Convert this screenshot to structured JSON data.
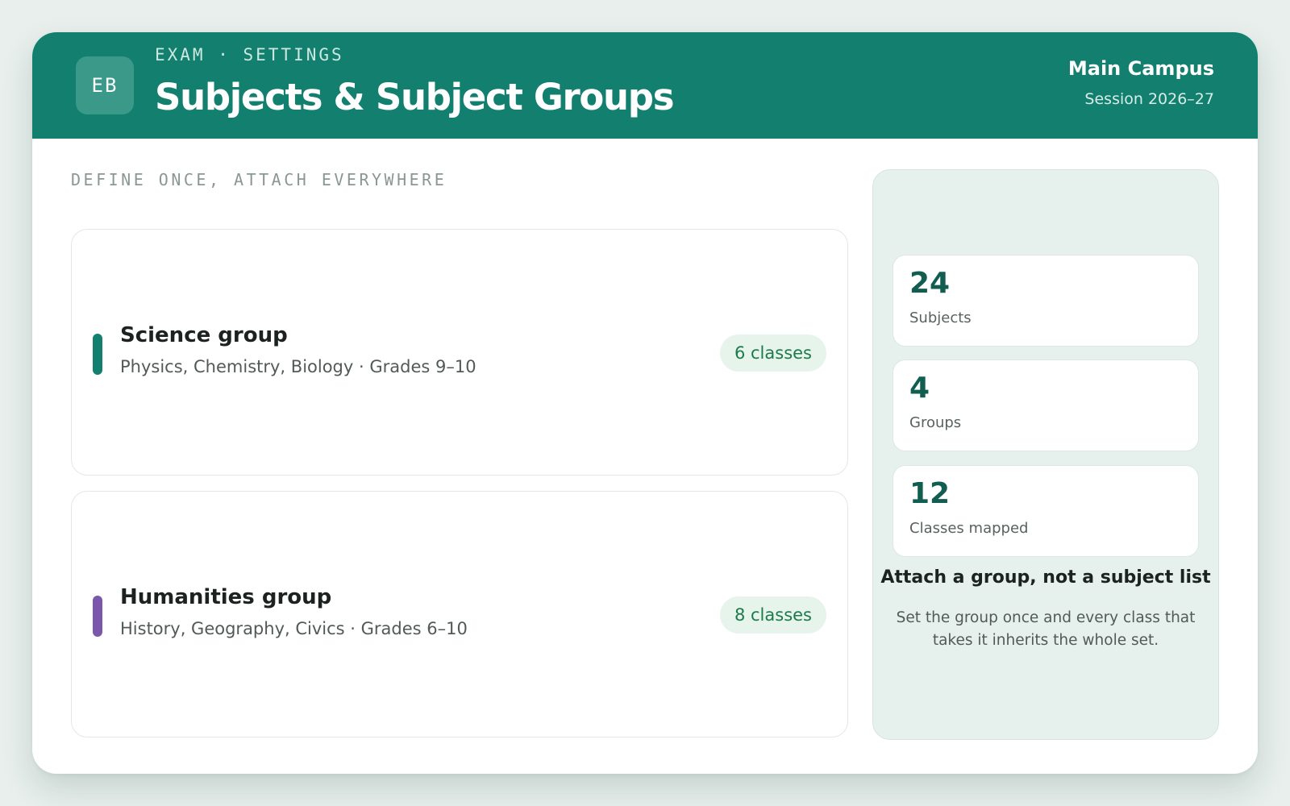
{
  "header": {
    "logo_text": "EB",
    "eyebrow": "EXAM · SETTINGS",
    "title": "Subjects & Subject Groups",
    "campus": "Main Campus",
    "session": "Session 2026–27"
  },
  "main": {
    "section_label": "DEFINE ONCE, ATTACH EVERYWHERE",
    "groups": [
      {
        "name": "Science group",
        "description": "Physics, Chemistry, Biology · Grades 9–10",
        "classes": "6 classes",
        "accent_color": "#137f6f"
      },
      {
        "name": "Humanities group",
        "description": "History, Geography, Civics · Grades 6–10",
        "classes": "8 classes",
        "accent_color": "#7b57ab"
      }
    ]
  },
  "summary": {
    "stats": [
      {
        "value": "24",
        "label": "Subjects"
      },
      {
        "value": "4",
        "label": "Groups"
      },
      {
        "value": "12",
        "label": "Classes mapped"
      }
    ],
    "tip_title": "Attach a group, not a subject list",
    "tip_text": "Set the group once and every class that takes it inherits the whole set."
  },
  "colors": {
    "brand": "#137f6f",
    "pill_background": "#e6f4ec",
    "pill_text": "#1d7a4a",
    "stat_value": "#115e51"
  }
}
